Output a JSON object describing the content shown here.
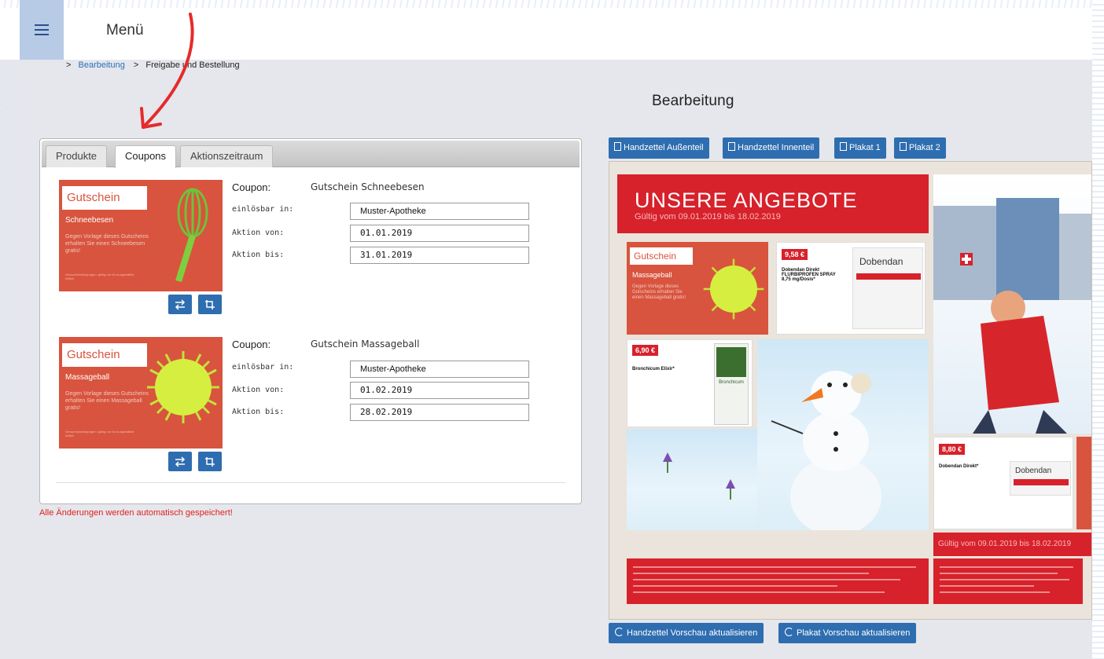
{
  "header": {
    "menu_title": "Menü"
  },
  "breadcrumb": {
    "sep": ">",
    "items": [
      "Bearbeitung",
      "Freigabe und Bestellung"
    ]
  },
  "page_heading": "Bearbeitung",
  "tabs": [
    {
      "label": "Produkte",
      "active": false
    },
    {
      "label": "Coupons",
      "active": true
    },
    {
      "label": "Aktionszeitraum",
      "active": false
    }
  ],
  "coupons": [
    {
      "image": {
        "label": "Gutschein",
        "name": "Schneebesen",
        "desc": "Gegen Vorlage dieses Gutscheins erhalten Sie einen Schneebesen gratis!",
        "fine": "Versuchsbedingungen: gültig nur für ausgewählte Artikel"
      },
      "coupon_key": "Coupon:",
      "coupon_value": "Gutschein Schneebesen",
      "labels": {
        "redeemable": "einlösbar in:",
        "from": "Aktion von:",
        "to": "Aktion bis:"
      },
      "redeemable": "Muster-Apotheke",
      "from": "01.01.2019",
      "to": "31.01.2019"
    },
    {
      "image": {
        "label": "Gutschein",
        "name": "Massageball",
        "desc": "Gegen Vorlage dieses Gutscheins erhalten Sie einen Massageball gratis!",
        "fine": "Versuchsbedingungen: gültig nur für ausgewählte Artikel"
      },
      "coupon_key": "Coupon:",
      "coupon_value": "Gutschein Massageball",
      "labels": {
        "redeemable": "einlösbar in:",
        "from": "Aktion von:",
        "to": "Aktion bis:"
      },
      "redeemable": "Muster-Apotheke",
      "from": "01.02.2019",
      "to": "28.02.2019"
    }
  ],
  "autosave_note": "Alle Änderungen werden automatisch gespeichert!",
  "doc_buttons": [
    "Handzettel Außenteil",
    "Handzettel Innenteil",
    "Plakat 1",
    "Plakat 2"
  ],
  "preview": {
    "headline": "UNSERE ANGEBOTE",
    "validity": "Gültig vom 09.01.2019 bis 18.02.2019",
    "coupon_label": "Gutschein",
    "coupon_name": "Massageball",
    "coupon_desc": "Gegen Vorlage dieses Gutscheins erhalten Sie einen Massageball gratis!",
    "products": [
      {
        "price": "9,58 €",
        "name": "Dobendan Direkt FLURBIPROFEN SPRAY 8,75 mg/Dosis*",
        "brand": "Dobendan"
      },
      {
        "price": "6,90 €",
        "name": "Bronchicum Elixir*",
        "brand": "Bronchicum"
      },
      {
        "price": "8,80 €",
        "name": "Dobendan Direkt*",
        "brand": "Dobendan"
      }
    ],
    "validity_2": "Gültig vom 09.01.2019 bis 18.02.2019"
  },
  "refresh_buttons": [
    "Handzettel Vorschau aktualisieren",
    "Plakat Vorschau aktualisieren"
  ],
  "colors": {
    "accent": "#2e6db0",
    "coupon": "#d8543e",
    "flyer_red": "#d7212b",
    "warning": "#e0201f"
  }
}
